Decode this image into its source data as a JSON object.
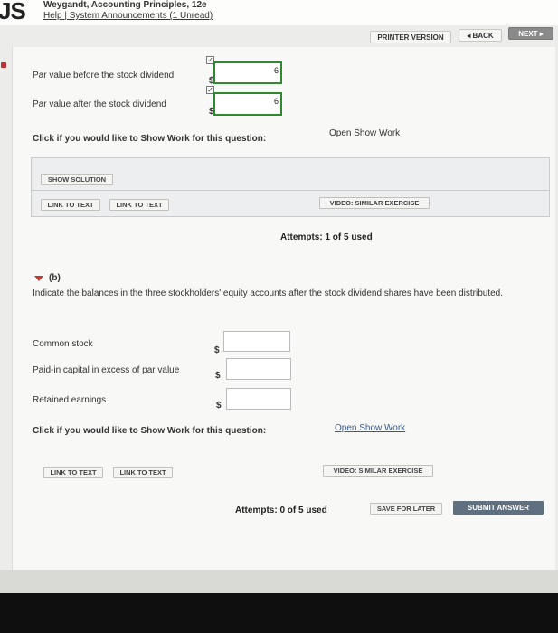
{
  "header": {
    "logo": "JS",
    "book_title": "Weygandt, Accounting Principles, 12e",
    "help": "Help",
    "separator": " | ",
    "announcements": "System Announcements (1 Unread)"
  },
  "nav": {
    "printer": "PRINTER VERSION",
    "back": "◂ BACK",
    "next": "NEXT ▸"
  },
  "part_a": {
    "par_before_label": "Par value before the stock dividend",
    "par_before_value": "6",
    "par_after_label": "Par value after the stock dividend",
    "par_after_value": "6",
    "currency": "$",
    "show_work_prompt": "Click if you would like to Show Work for this question:",
    "show_work_link": "Open Show Work",
    "show_solution": "SHOW SOLUTION",
    "link_to_text_1": "LINK TO TEXT",
    "link_to_text_2": "LINK TO TEXT",
    "video": "VIDEO: SIMILAR EXERCISE",
    "attempts": "Attempts: 1 of 5 used"
  },
  "part_b": {
    "heading": "(b)",
    "instruction": "Indicate the balances in the three stockholders' equity accounts after the stock dividend shares have been distributed.",
    "rows": [
      {
        "label": "Common stock",
        "currency": "$",
        "value": ""
      },
      {
        "label": "Paid-in capital in excess of par value",
        "currency": "$",
        "value": ""
      },
      {
        "label": "Retained earnings",
        "currency": "$",
        "value": ""
      }
    ],
    "show_work_prompt": "Click if you would like to Show Work for this question:",
    "show_work_link": "Open Show Work",
    "link_to_text_1": "LINK TO TEXT",
    "link_to_text_2": "LINK TO TEXT",
    "video": "VIDEO: SIMILAR EXERCISE",
    "attempts": "Attempts: 0 of 5 used",
    "save": "SAVE FOR LATER",
    "submit": "SUBMIT ANSWER"
  },
  "colors": {
    "accent_green": "#2f8a2f",
    "submit_bg": "#607080",
    "arrow_red": "#c0392b"
  }
}
